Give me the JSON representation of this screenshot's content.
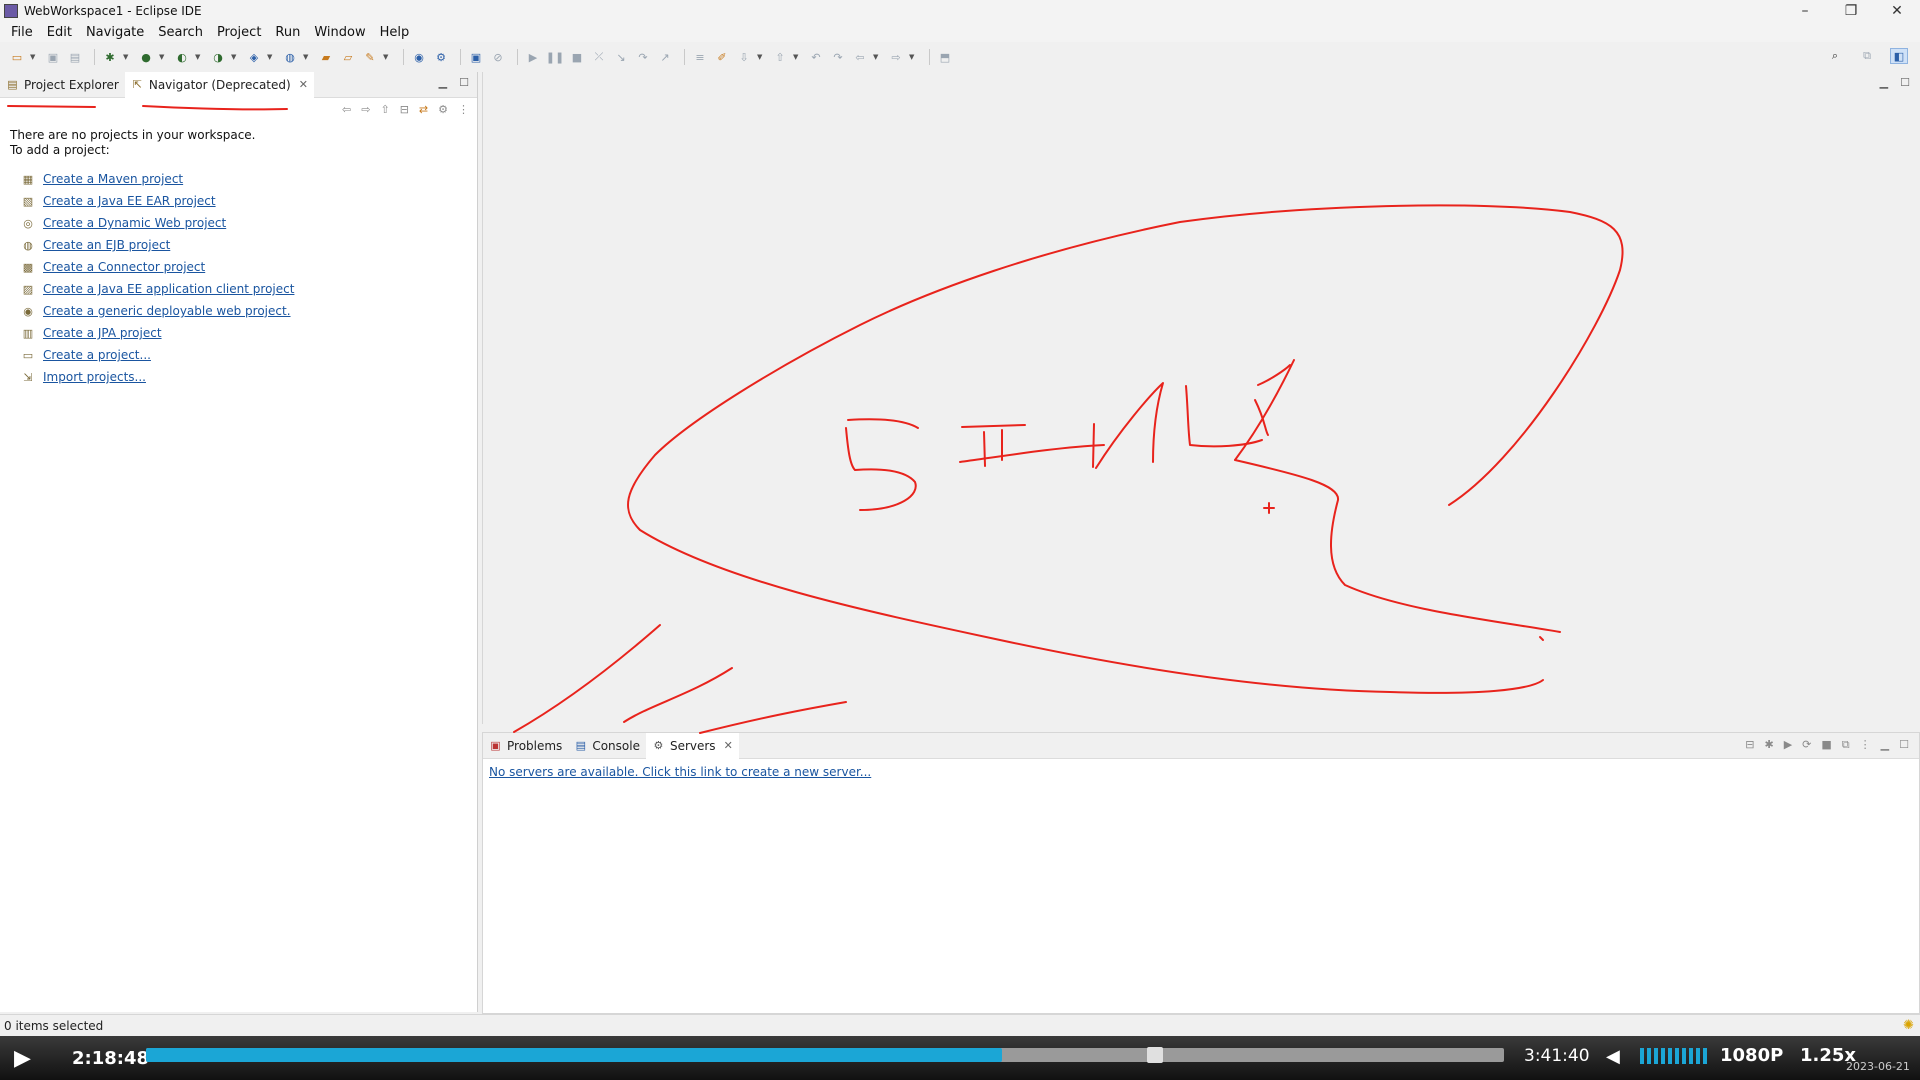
{
  "window": {
    "title": "WebWorkspace1 - Eclipse IDE",
    "minimize": "–",
    "restore": "❐",
    "close": "✕"
  },
  "menu": [
    "File",
    "Edit",
    "Navigate",
    "Search",
    "Project",
    "Run",
    "Window",
    "Help"
  ],
  "left_panel": {
    "tabs": [
      {
        "label": "Project Explorer",
        "icon": "project-explorer-icon"
      },
      {
        "label": "Navigator (Deprecated)",
        "icon": "navigator-icon"
      }
    ],
    "intro_line1": "There are no projects in your workspace.",
    "intro_line2": "To add a project:",
    "links": [
      {
        "label": "Create a Maven project",
        "icon": "maven-icon"
      },
      {
        "label": "Create a Java EE EAR project",
        "icon": "ear-project-icon"
      },
      {
        "label": "Create a Dynamic Web project",
        "icon": "web-project-icon"
      },
      {
        "label": "Create an EJB project",
        "icon": "ejb-project-icon"
      },
      {
        "label": "Create a Connector project",
        "icon": "connector-project-icon"
      },
      {
        "label": "Create a Java EE application client project",
        "icon": "app-client-icon"
      },
      {
        "label": "Create a generic deployable web project.",
        "icon": "generic-web-icon"
      },
      {
        "label": "Create a JPA project",
        "icon": "jpa-project-icon"
      },
      {
        "label": "Create a project...",
        "icon": "new-project-icon"
      },
      {
        "label": "Import projects...",
        "icon": "import-icon"
      }
    ]
  },
  "bottom_panel": {
    "tabs": [
      {
        "label": "Problems",
        "icon": "problems-icon"
      },
      {
        "label": "Console",
        "icon": "console-icon"
      },
      {
        "label": "Servers",
        "icon": "servers-icon"
      }
    ],
    "server_link": "No servers are available. Click this link to create a new server..."
  },
  "status": {
    "selection": "0 items selected"
  },
  "player": {
    "current_time": "2:18:48",
    "total_time": "3:41:40",
    "progress": 0.63,
    "quality": "1080P",
    "speed": "1.25x",
    "date": "2023-06-21"
  },
  "colors": {
    "annotation": "#e8231c",
    "link": "#1a55a0",
    "seek_fill": "#1ba6d6"
  }
}
